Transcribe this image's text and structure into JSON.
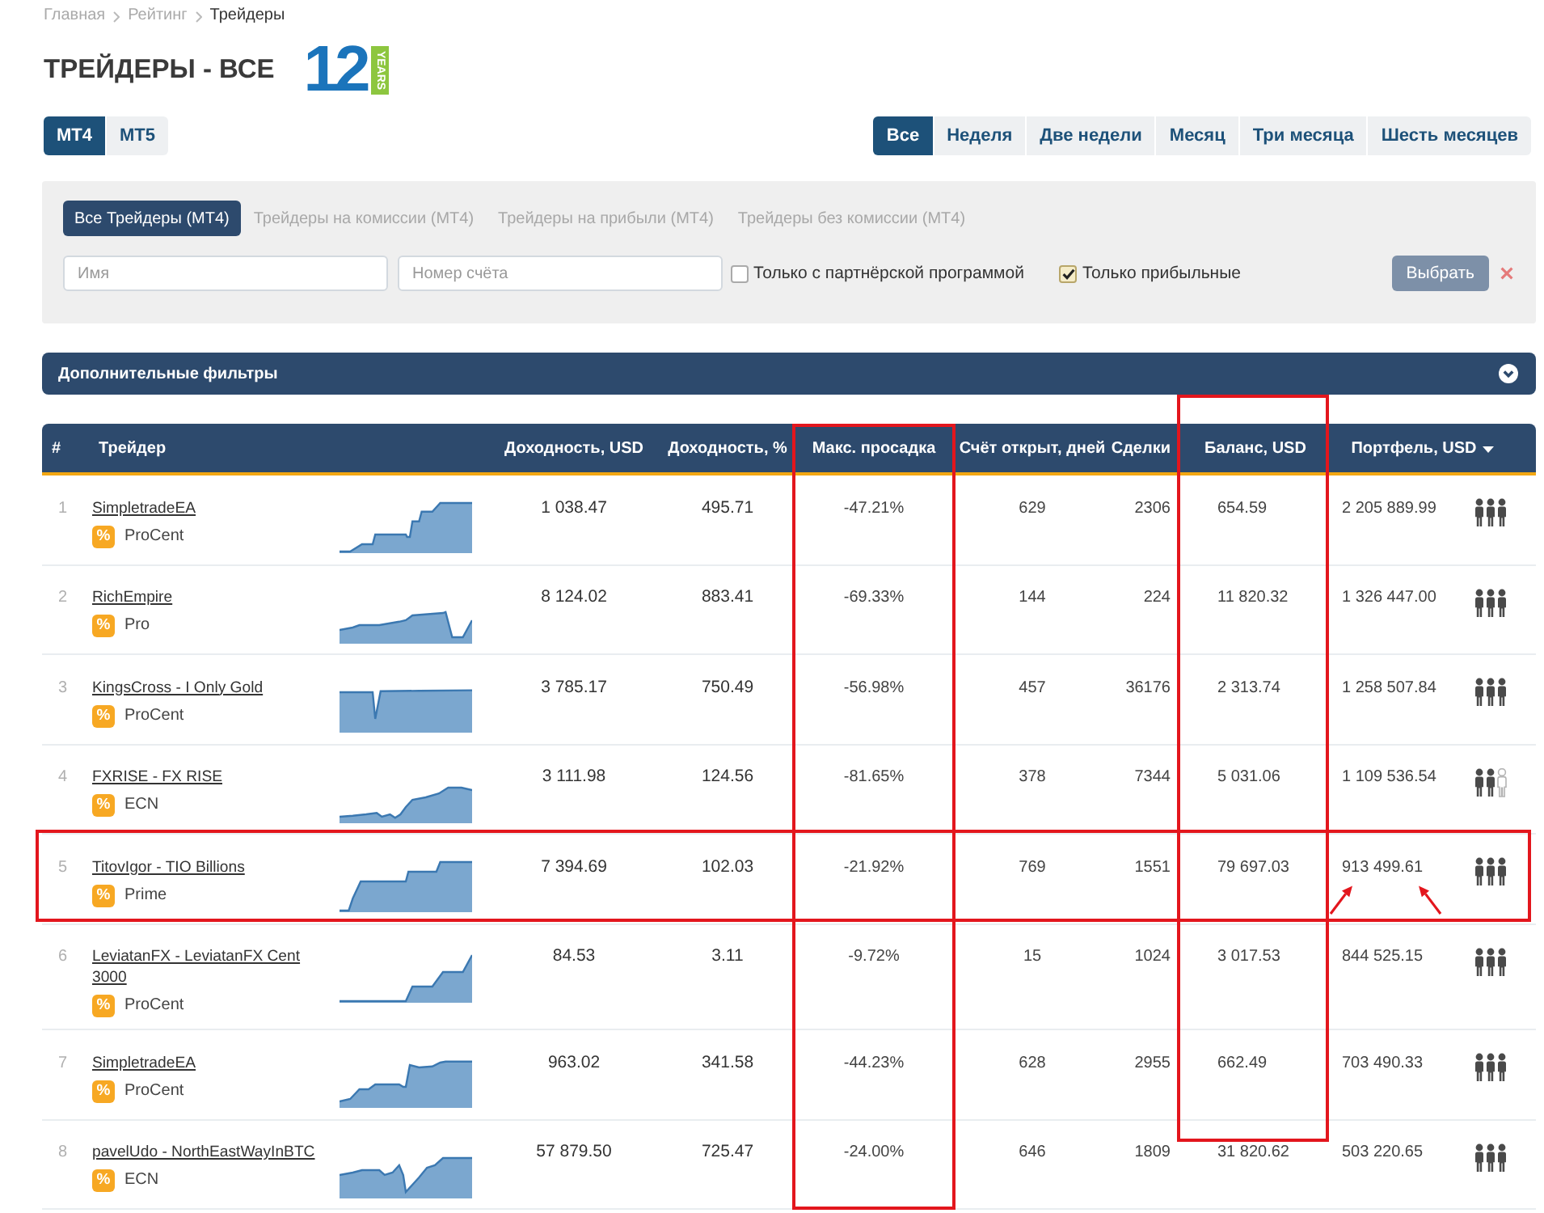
{
  "breadcrumbs": [
    {
      "label": "Главная",
      "current": false
    },
    {
      "label": "Рейтинг",
      "current": false
    },
    {
      "label": "Трейдеры",
      "current": true
    }
  ],
  "title": "ТРЕЙДЕРЫ - ВСЕ",
  "logo": {
    "number": "12",
    "ribbon": "YEARS"
  },
  "platform_tabs": [
    {
      "label": "MT4",
      "selected": true
    },
    {
      "label": "MT5",
      "selected": false
    }
  ],
  "period_tabs": [
    {
      "label": "Все",
      "selected": true
    },
    {
      "label": "Неделя",
      "selected": false
    },
    {
      "label": "Две недели",
      "selected": false
    },
    {
      "label": "Месяц",
      "selected": false
    },
    {
      "label": "Три месяца",
      "selected": false
    },
    {
      "label": "Шесть месяцев",
      "selected": false
    }
  ],
  "filters": {
    "tabs": [
      {
        "label": "Все Трейдеры (MT4)",
        "selected": true
      },
      {
        "label": "Трейдеры на комиссии (MT4)",
        "selected": false
      },
      {
        "label": "Трейдеры на прибыли (MT4)",
        "selected": false
      },
      {
        "label": "Трейдеры без комиссии (MT4)",
        "selected": false
      }
    ],
    "fields": [
      {
        "placeholder": "Имя"
      },
      {
        "placeholder": "Номер счёта"
      }
    ],
    "checkboxes": [
      {
        "label": "Только с партнёрской программой",
        "checked": false
      },
      {
        "label": "Только прибыльные",
        "checked": true
      }
    ],
    "submit": "Выбрать"
  },
  "additional_filters": {
    "label": "Дополнительные фильтры",
    "expanded": false
  },
  "table": {
    "columns": [
      {
        "label": "#",
        "sorted": false,
        "marked": false
      },
      {
        "label": "Трейдер",
        "sorted": false,
        "marked": false
      },
      {
        "label": "Доходность, USD",
        "sorted": false,
        "marked": false
      },
      {
        "label": "Доходность, %",
        "sorted": false,
        "marked": false
      },
      {
        "label": "Макс. просадка",
        "sorted": false,
        "marked": true
      },
      {
        "label": "Счёт открыт, дней",
        "sorted": false,
        "marked": false
      },
      {
        "label": "Сделки",
        "sorted": false,
        "marked": false
      },
      {
        "label": "Баланс, USD",
        "sorted": false,
        "marked": true
      },
      {
        "label": "Портфель, USD",
        "sorted": true,
        "marked": false
      }
    ],
    "rows": [
      {
        "rank": "1",
        "name": "SimpletradeEA",
        "badge": "%",
        "account_type": "ProCent",
        "income_usd": "1 038.47",
        "income_pct": "495.71",
        "max_drawdown": "-47.21%",
        "days_open": "629",
        "trades": "2306",
        "balance": "654.59",
        "portfolio": "2 205 889.99",
        "people": [
          {
            "filled": true
          },
          {
            "filled": true
          },
          {
            "filled": true
          }
        ],
        "marked": false,
        "arrows": false
      },
      {
        "rank": "2",
        "name": "RichEmpire",
        "badge": "%",
        "account_type": "Pro",
        "income_usd": "8 124.02",
        "income_pct": "883.41",
        "max_drawdown": "-69.33%",
        "days_open": "144",
        "trades": "224",
        "balance": "11 820.32",
        "portfolio": "1 326 447.00",
        "people": [
          {
            "filled": true
          },
          {
            "filled": true
          },
          {
            "filled": true
          }
        ],
        "marked": false,
        "arrows": false
      },
      {
        "rank": "3",
        "name": "KingsCross - I Only Gold",
        "badge": "%",
        "account_type": "ProCent",
        "income_usd": "3 785.17",
        "income_pct": "750.49",
        "max_drawdown": "-56.98%",
        "days_open": "457",
        "trades": "36176",
        "balance": "2 313.74",
        "portfolio": "1 258 507.84",
        "people": [
          {
            "filled": true
          },
          {
            "filled": true
          },
          {
            "filled": true
          }
        ],
        "marked": false,
        "arrows": false
      },
      {
        "rank": "4",
        "name": "FXRISE - FX RISE",
        "badge": "%",
        "account_type": "ECN",
        "income_usd": "3 111.98",
        "income_pct": "124.56",
        "max_drawdown": "-81.65%",
        "days_open": "378",
        "trades": "7344",
        "balance": "5 031.06",
        "portfolio": "1 109 536.54",
        "people": [
          {
            "filled": true
          },
          {
            "filled": true
          },
          {
            "filled": false
          }
        ],
        "marked": false,
        "arrows": false
      },
      {
        "rank": "5",
        "name": "TitovIgor - TIO Billions",
        "badge": "%",
        "account_type": "Prime",
        "income_usd": "7 394.69",
        "income_pct": "102.03",
        "max_drawdown": "-21.92%",
        "days_open": "769",
        "trades": "1551",
        "balance": "79 697.03",
        "portfolio": "913 499.61",
        "people": [
          {
            "filled": true
          },
          {
            "filled": true
          },
          {
            "filled": true
          }
        ],
        "marked": true,
        "arrows": true
      },
      {
        "rank": "6",
        "name": "LeviatanFX - LeviatanFX Cent 3000",
        "badge": "%",
        "account_type": "ProCent",
        "income_usd": "84.53",
        "income_pct": "3.11",
        "max_drawdown": "-9.72%",
        "days_open": "15",
        "trades": "1024",
        "balance": "3 017.53",
        "portfolio": "844 525.15",
        "people": [
          {
            "filled": true
          },
          {
            "filled": true
          },
          {
            "filled": true
          }
        ],
        "marked": false,
        "arrows": false
      },
      {
        "rank": "7",
        "name": "SimpletradeEA",
        "badge": "%",
        "account_type": "ProCent",
        "income_usd": "963.02",
        "income_pct": "341.58",
        "max_drawdown": "-44.23%",
        "days_open": "628",
        "trades": "2955",
        "balance": "662.49",
        "portfolio": "703 490.33",
        "people": [
          {
            "filled": true
          },
          {
            "filled": true
          },
          {
            "filled": true
          }
        ],
        "marked": false,
        "arrows": false
      },
      {
        "rank": "8",
        "name": "pavelUdo - NorthEastWayInBTC",
        "badge": "%",
        "account_type": "ECN",
        "income_usd": "57 879.50",
        "income_pct": "725.47",
        "max_drawdown": "-24.00%",
        "days_open": "646",
        "trades": "1809",
        "balance": "31 820.62",
        "portfolio": "503 220.65",
        "people": [
          {
            "filled": true
          },
          {
            "filled": true
          },
          {
            "filled": true
          }
        ],
        "marked": false,
        "arrows": false
      }
    ]
  }
}
